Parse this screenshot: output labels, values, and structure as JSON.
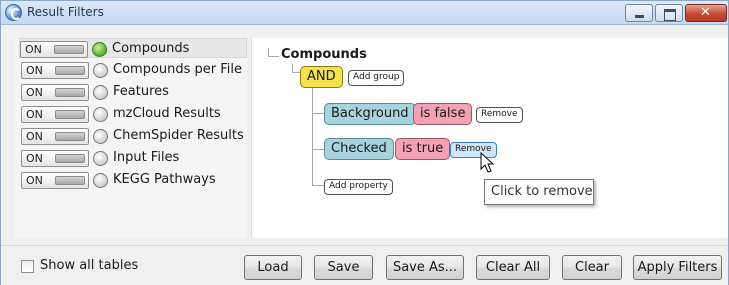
{
  "window": {
    "title": "Result Filters"
  },
  "tables": [
    {
      "toggle": "ON",
      "label": "Compounds",
      "active": true
    },
    {
      "toggle": "ON",
      "label": "Compounds per File",
      "active": false
    },
    {
      "toggle": "ON",
      "label": "Features",
      "active": false
    },
    {
      "toggle": "ON",
      "label": "mzCloud Results",
      "active": false
    },
    {
      "toggle": "ON",
      "label": "ChemSpider Results",
      "active": false
    },
    {
      "toggle": "ON",
      "label": "Input Files",
      "active": false
    },
    {
      "toggle": "ON",
      "label": "KEGG Pathways",
      "active": false
    }
  ],
  "filter": {
    "root": "Compounds",
    "operator": "AND",
    "add_group": "Add group",
    "conditions": [
      {
        "property": "Background",
        "op": "is false",
        "remove": "Remove"
      },
      {
        "property": "Checked",
        "op": "is true",
        "remove": "Remove"
      }
    ],
    "add_property": "Add property",
    "tooltip": "Click to remove"
  },
  "bottom": {
    "show_all_label": "Show all tables",
    "show_all_checked": false,
    "buttons": {
      "load": "Load",
      "save": "Save",
      "save_as": "Save As...",
      "clear_all": "Clear All",
      "clear": "Clear",
      "apply": "Apply Filters"
    }
  },
  "colors": {
    "and_chip": "#f6e14a",
    "property_chip": "#a7d4dc",
    "operator_chip": "#f4a2b3",
    "active_dot": "#63b83c"
  }
}
